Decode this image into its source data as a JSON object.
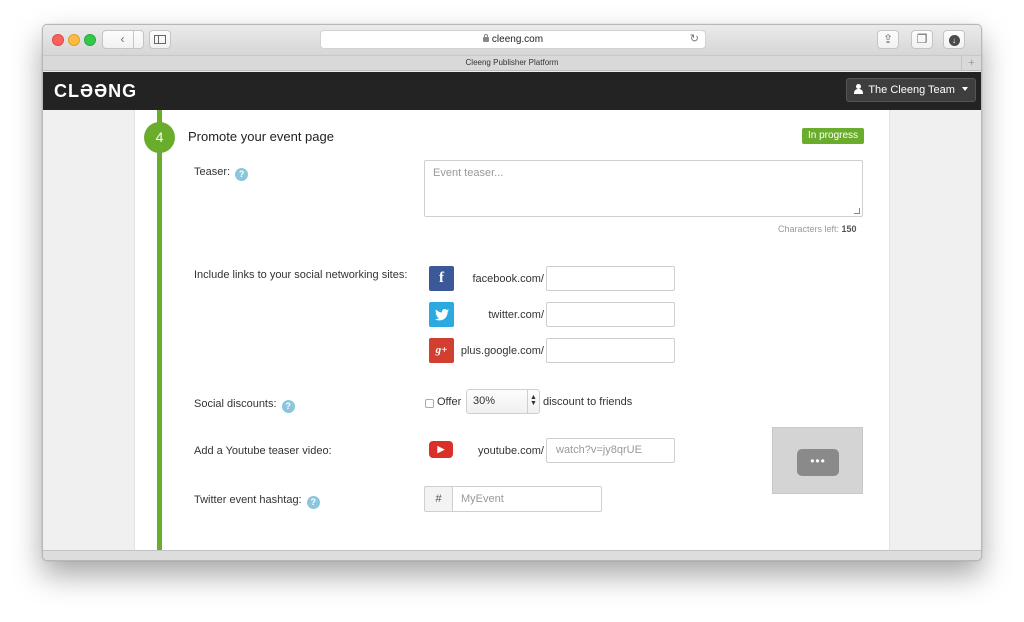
{
  "browser": {
    "url": "cleeng.com",
    "tab_title": "Cleeng Publisher Platform",
    "back_glyph": "‹",
    "forward_glyph": "›"
  },
  "app": {
    "logo": "CLƏƏNG",
    "user_menu": "The Cleeng Team",
    "accent_color": "#6aad2c"
  },
  "step": {
    "number": "4",
    "title": "Promote your event page",
    "status": "In progress"
  },
  "teaser": {
    "label": "Teaser:",
    "placeholder": "Event teaser...",
    "chars_left_label": "Characters left:",
    "chars_left_value": "150"
  },
  "social_links": {
    "label": "Include links to your social networking sites:",
    "items": [
      {
        "icon": "facebook-icon",
        "glyph": "f",
        "prefix": "facebook.com/",
        "value": ""
      },
      {
        "icon": "twitter-icon",
        "glyph": "🐦",
        "prefix": "twitter.com/",
        "value": ""
      },
      {
        "icon": "google-plus-icon",
        "glyph": "g+",
        "prefix": "plus.google.com/",
        "value": ""
      }
    ]
  },
  "social_discounts": {
    "label": "Social discounts:",
    "offer_label": "Offer",
    "selected_value": "30%",
    "suffix": "discount to friends"
  },
  "youtube": {
    "label": "Add a Youtube teaser video:",
    "prefix": "youtube.com/",
    "placeholder": "watch?v=jy8qrUE",
    "glyph": "▶",
    "thumb_glyph": "•••"
  },
  "hashtag": {
    "label": "Twitter event hashtag:",
    "addon": "#",
    "placeholder": "MyEvent"
  },
  "help_glyph": "?"
}
